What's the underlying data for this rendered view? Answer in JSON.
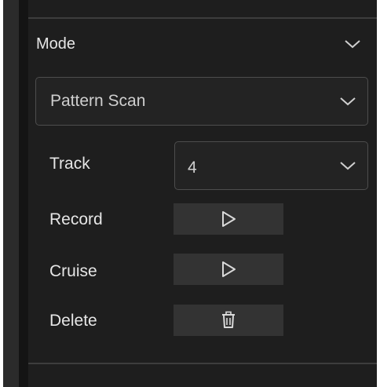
{
  "mode_section": {
    "title": "Mode",
    "expand_icon": "chevron-down-icon"
  },
  "mode_select": {
    "value": "Pattern Scan",
    "icon": "chevron-down-icon"
  },
  "track": {
    "label": "Track",
    "value": "4",
    "icon": "chevron-down-icon"
  },
  "record": {
    "label": "Record",
    "icon": "play-icon"
  },
  "cruise": {
    "label": "Cruise",
    "icon": "play-icon"
  },
  "delete": {
    "label": "Delete",
    "icon": "trash-icon"
  },
  "colors": {
    "panel_bg": "#1e1e1e",
    "button_bg": "#333333",
    "text": "#e6e6e6"
  }
}
